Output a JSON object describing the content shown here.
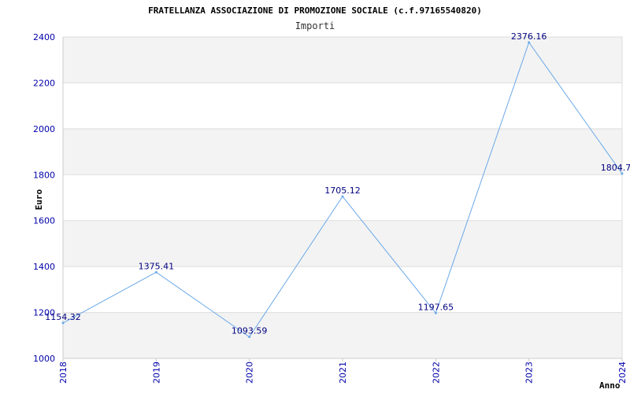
{
  "chart_data": {
    "type": "line",
    "title": "FRATELLANZA ASSOCIAZIONE DI PROMOZIONE SOCIALE (c.f.97165540820)",
    "subtitle": "Importi",
    "xlabel": "Anno",
    "ylabel": "Euro",
    "categories": [
      "2018",
      "2019",
      "2020",
      "2021",
      "2022",
      "2023",
      "2024"
    ],
    "series": [
      {
        "values": [
          1154.32,
          1375.41,
          1093.59,
          1705.12,
          1197.65,
          2376.16,
          1804.7
        ]
      }
    ],
    "data_labels": [
      "1154.32",
      "1375.41",
      "1093.59",
      "1705.12",
      "1197.65",
      "2376.16",
      "1804.7"
    ],
    "ylim": [
      1000,
      2400
    ],
    "yticks": [
      "1000",
      "1200",
      "1400",
      "1600",
      "1800",
      "2000",
      "2200",
      "2400"
    ],
    "grid": true,
    "banded_background": true,
    "colors": {
      "line": "#6aa8e8",
      "band": "#f3f3f3",
      "grid": "#dddddd",
      "tick_text": "#0000aa",
      "label_text": "#000080"
    }
  }
}
